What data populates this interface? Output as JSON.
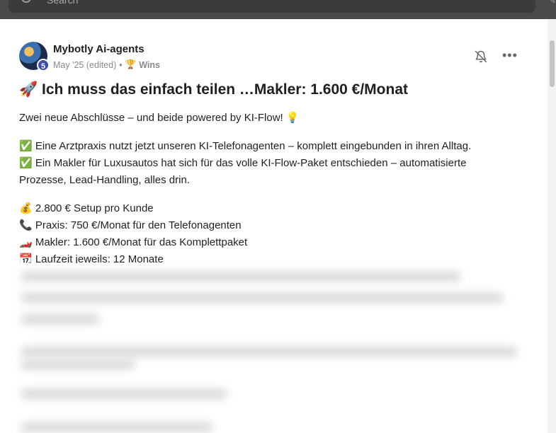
{
  "search": {
    "placeholder": "Search"
  },
  "post": {
    "author": "Mybotly Ai-agents",
    "level": "5",
    "date": "May '25 (edited)",
    "separator": "•",
    "category_icon": "🏆",
    "category": "Wins",
    "title": "🚀 Ich muss das einfach teilen …Makler: 1.600 €/Monat",
    "intro": "Zwei neue Abschlüsse – und beide powered by KI-Flow! 💡",
    "wins": [
      "✅ Eine Arztpraxis nutzt jetzt unseren KI-Telefonagenten – komplett eingebunden in ihren Alltag.",
      "✅ Ein Makler für Luxusautos hat sich für das volle KI-Flow-Paket entschieden – automatisierte",
      "Prozesse, Lead-Handling, alles drin."
    ],
    "facts": [
      "💰 2.800 € Setup pro Kunde",
      "📞 Praxis: 750 €/Monat für den Telefonagenten",
      "🏎️ Makler: 1.600 €/Monat für das Komplettpaket",
      "📆 Laufzeit jeweils: 12 Monate"
    ]
  },
  "icons": {
    "search": "search-icon",
    "bell": "bell-off-icon",
    "more": "more-horizontal-icon"
  }
}
